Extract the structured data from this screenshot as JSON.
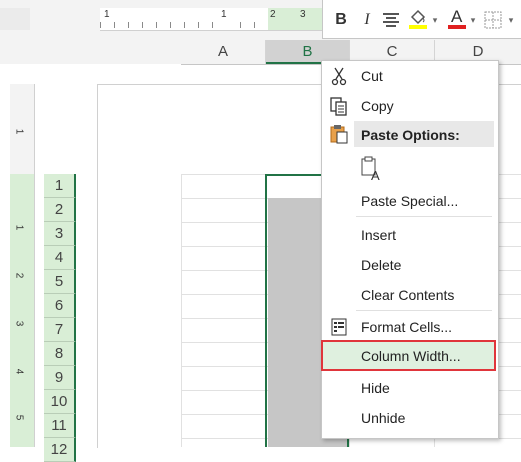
{
  "ruler": {
    "h_numbers": [
      "1",
      "1",
      "2",
      "3"
    ],
    "v_numbers": [
      "1",
      "1",
      "2",
      "3",
      "4",
      "5"
    ]
  },
  "columns": [
    "A",
    "B",
    "C",
    "D"
  ],
  "rows": [
    "1",
    "2",
    "3",
    "4",
    "5",
    "6",
    "7",
    "8",
    "9",
    "10",
    "11",
    "12"
  ],
  "mini_toolbar": {
    "bold": "B",
    "italic": "I",
    "font_color_letter": "A",
    "fill_color": "#ffff00",
    "font_color": "#e02020"
  },
  "context_menu": {
    "cut": "Cut",
    "copy": "Copy",
    "paste_options": "Paste Options:",
    "paste_special": "Paste Special...",
    "insert": "Insert",
    "delete": "Delete",
    "clear_contents": "Clear Contents",
    "format_cells": "Format Cells...",
    "column_width": "Column Width...",
    "hide": "Hide",
    "unhide": "Unhide"
  },
  "colors": {
    "accent": "#217346",
    "highlight_border": "#e0353b",
    "selection_fill": "#c6c6c6"
  }
}
